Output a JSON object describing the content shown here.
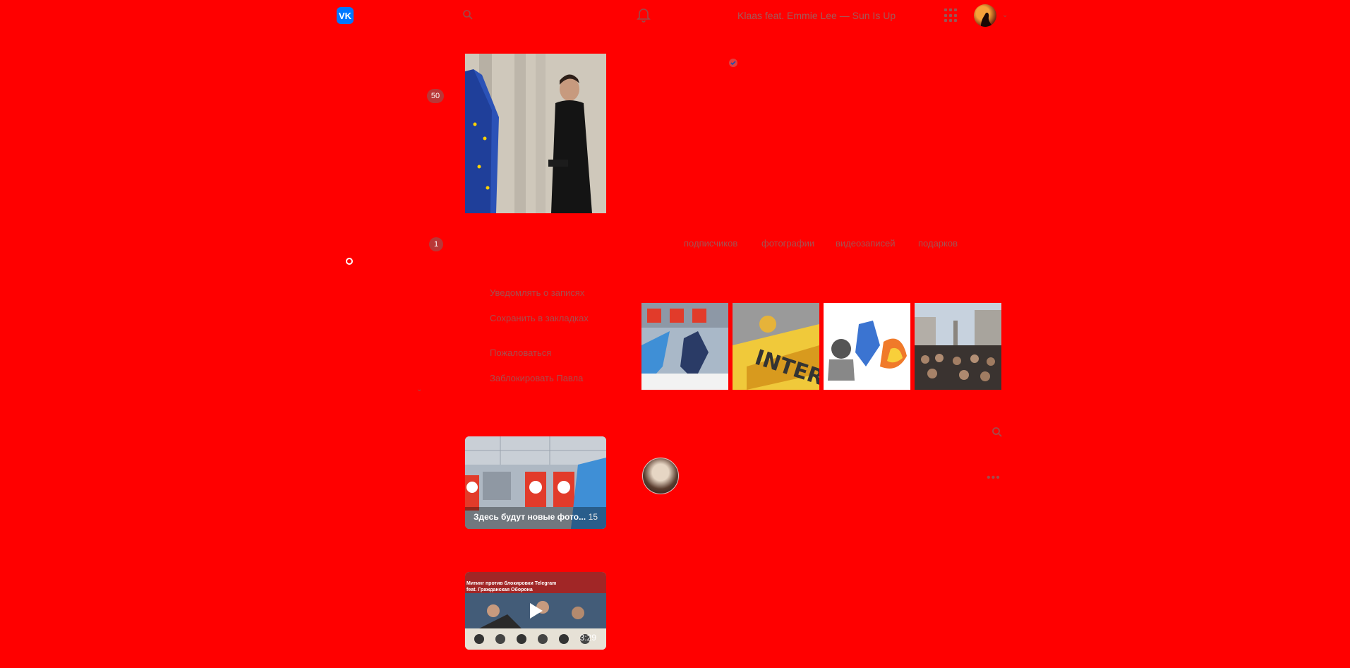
{
  "header": {
    "logo_text": "VK",
    "now_playing": "Klaas feat. Emmie Lee — Sun Is Up"
  },
  "left_menu": {
    "badge_messages": "50",
    "badge_other": "1"
  },
  "profile_actions": [
    {
      "label": "Уведомлять о записях"
    },
    {
      "label": "Сохранить в закладках"
    },
    {
      "label": "Пожаловаться"
    },
    {
      "label": "Заблокировать Павла"
    }
  ],
  "counters": [
    {
      "label": "подписчиков"
    },
    {
      "label": "фотографии"
    },
    {
      "label": "видеозаписей"
    },
    {
      "label": "подарков"
    }
  ],
  "album": {
    "title": "Здесь будут новые фото...",
    "count": "15"
  },
  "video": {
    "title_line1": "Митинг против блокировки Telegram",
    "title_line2": "feat. Гражданская Оборона",
    "duration": "3:29"
  },
  "colors": {
    "background": "#ff0000",
    "brand": "#0077ff"
  }
}
